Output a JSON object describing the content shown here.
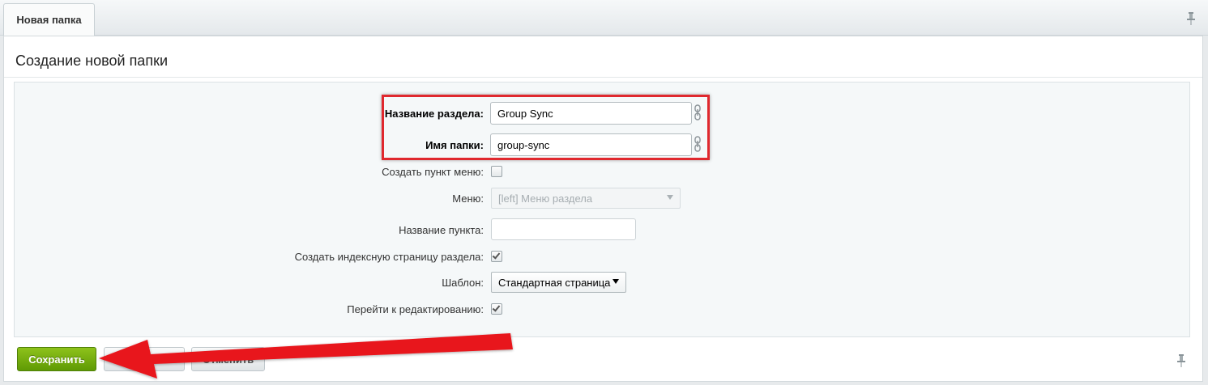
{
  "tab": {
    "label": "Новая папка"
  },
  "page_title": "Создание новой папки",
  "form": {
    "section_name": {
      "label": "Название раздела:",
      "value": "Group Sync"
    },
    "folder_name": {
      "label": "Имя папки:",
      "value": "group-sync"
    },
    "create_menu_item": {
      "label": "Создать пункт меню:",
      "checked": false
    },
    "menu": {
      "label": "Меню:",
      "value": "[left] Меню раздела"
    },
    "item_name": {
      "label": "Название пункта:",
      "value": ""
    },
    "create_index_page": {
      "label": "Создать индексную страницу раздела:",
      "checked": true
    },
    "template": {
      "label": "Шаблон:",
      "value": "Стандартная страница"
    },
    "go_to_editing": {
      "label": "Перейти к редактированию:",
      "checked": true
    }
  },
  "buttons": {
    "save": "Сохранить",
    "apply": "Применить",
    "cancel": "Отменить"
  },
  "colors": {
    "highlight": "#e0282e",
    "save_button": "#6fa80b",
    "annotation_arrow": "#e8141b"
  }
}
